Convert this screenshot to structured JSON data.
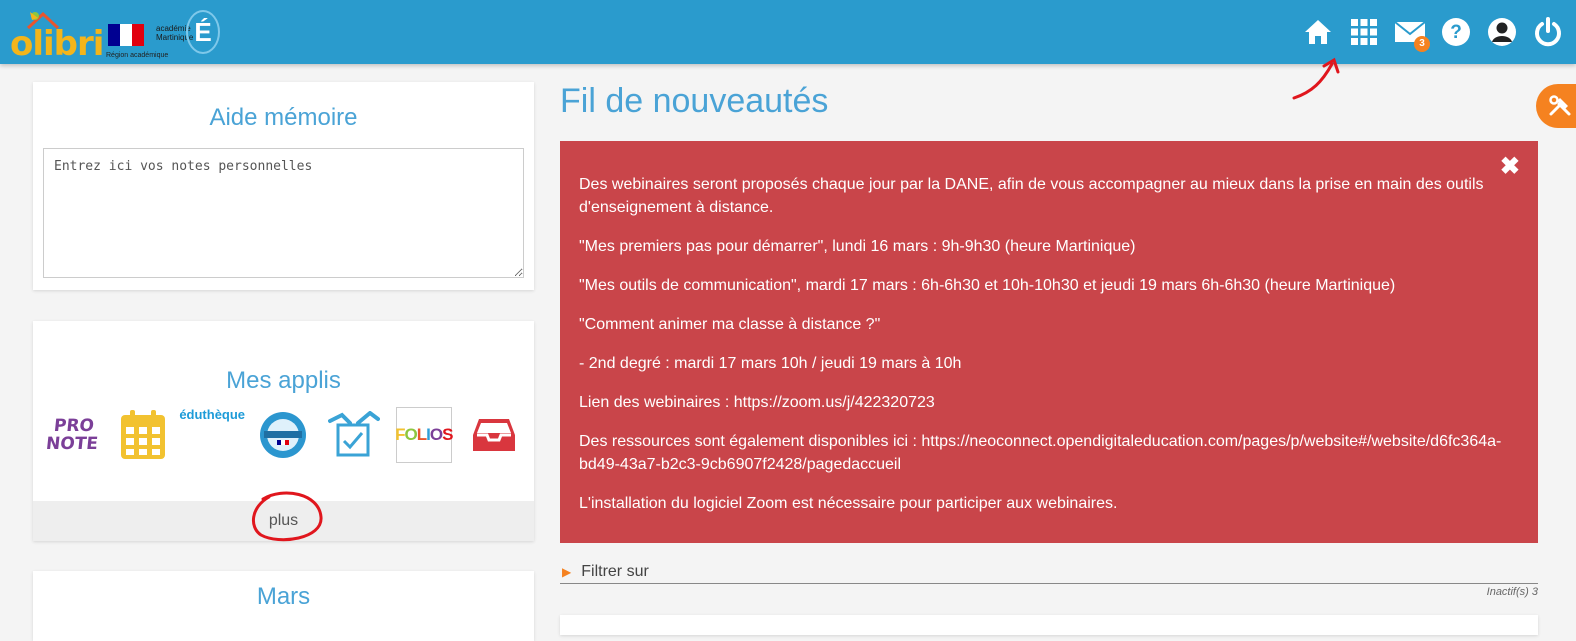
{
  "header": {
    "logo_text": "olibri",
    "region_label": "Région académique",
    "academie_label_line1": "académie",
    "academie_label_line2": "Martinique",
    "academie_letter": "É",
    "nav": [
      {
        "name": "home-icon"
      },
      {
        "name": "apps-grid-icon"
      },
      {
        "name": "mail-icon",
        "badge": "3"
      },
      {
        "name": "help-icon"
      },
      {
        "name": "user-icon"
      },
      {
        "name": "power-icon"
      }
    ]
  },
  "memo": {
    "title": "Aide mémoire",
    "placeholder": "Entrez ici vos notes personnelles"
  },
  "apps": {
    "title": "Mes applis",
    "items": [
      {
        "name": "pronote",
        "label_line1": "PRO",
        "label_line2": "NOTE"
      },
      {
        "name": "calendar",
        "icon": "calendar-icon"
      },
      {
        "name": "edutheque",
        "label": "éduthèque"
      },
      {
        "name": "ressources-numeriques",
        "icon": "badge-icon"
      },
      {
        "name": "exercizer",
        "icon": "exercise-icon"
      },
      {
        "name": "folios",
        "label": "FOLIOS"
      },
      {
        "name": "inbox",
        "icon": "inbox-icon"
      }
    ],
    "more_label": "plus"
  },
  "calendar_card": {
    "title": "Mars"
  },
  "main": {
    "title": "Fil de nouveautés",
    "alert_paragraphs": [
      "Des webinaires seront proposés chaque jour par la DANE, afin de vous accompagner au mieux dans la prise en main des outils d'enseignement à distance.",
      "\"Mes premiers pas pour démarrer\", lundi 16 mars : 9h-9h30 (heure Martinique)",
      "\"Mes outils de communication\", mardi 17 mars : 6h-6h30 et 10h-10h30 et jeudi 19 mars 6h-6h30 (heure Martinique)",
      "\"Comment animer ma classe à distance ?\"",
      "- 2nd degré : mardi 17 mars 10h / jeudi 19 mars à 10h",
      "Lien des webinaires : https://zoom.us/j/422320723",
      "Des ressources sont également disponibles ici : https://neoconnect.opendigitaleducation.com/pages/p/website#/website/d6fc364a-bd49-43a7-b2c3-9cb6907f2428/pagedaccueil",
      "L'installation du logiciel Zoom est nécessaire pour participer aux webinaires."
    ],
    "close_glyph": "✖",
    "filter_label": "Filtrer sur",
    "inactive_label": "Inactif(s) 3"
  },
  "colors": {
    "header_bg": "#2a9bcd",
    "accent_title": "#4aa3d6",
    "alert_bg": "#c9454a",
    "orange": "#f58220",
    "annotation_red": "#e0161d"
  }
}
